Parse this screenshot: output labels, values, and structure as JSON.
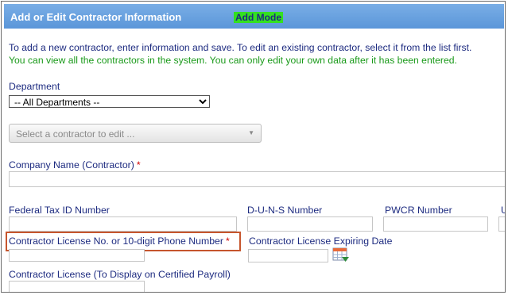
{
  "header": {
    "title": "Add or Edit Contractor Information",
    "mode": "Add Mode"
  },
  "intro": {
    "line1": "To add a new contractor, enter information and save. To edit an existing contractor, select it from the list first.",
    "line2": "You can view all the contractors in the system. You can only edit your own data after it has been entered."
  },
  "department": {
    "label": "Department",
    "selected": "-- All Departments --"
  },
  "contractor_select": {
    "placeholder": "Select a contractor to edit ..."
  },
  "fields": {
    "company_name": {
      "label": "Company Name (Contractor)",
      "required_mark": "*",
      "value": ""
    },
    "federal_tax_id": {
      "label": "Federal Tax ID Number",
      "value": ""
    },
    "duns": {
      "label": "D-U-N-S Number",
      "value": ""
    },
    "pwcr": {
      "label": "PWCR Number",
      "value": ""
    },
    "extra_col": {
      "label": "U",
      "value": ""
    },
    "license_no": {
      "label": "Contractor License No. or 10-digit Phone Number",
      "required_mark": "*",
      "value": ""
    },
    "license_expiry": {
      "label": "Contractor License Expiring Date",
      "value": ""
    },
    "license_display": {
      "label": "Contractor License (To Display on Certified Payroll)",
      "value": ""
    }
  },
  "icons": {
    "calendar": "calendar-icon"
  }
}
